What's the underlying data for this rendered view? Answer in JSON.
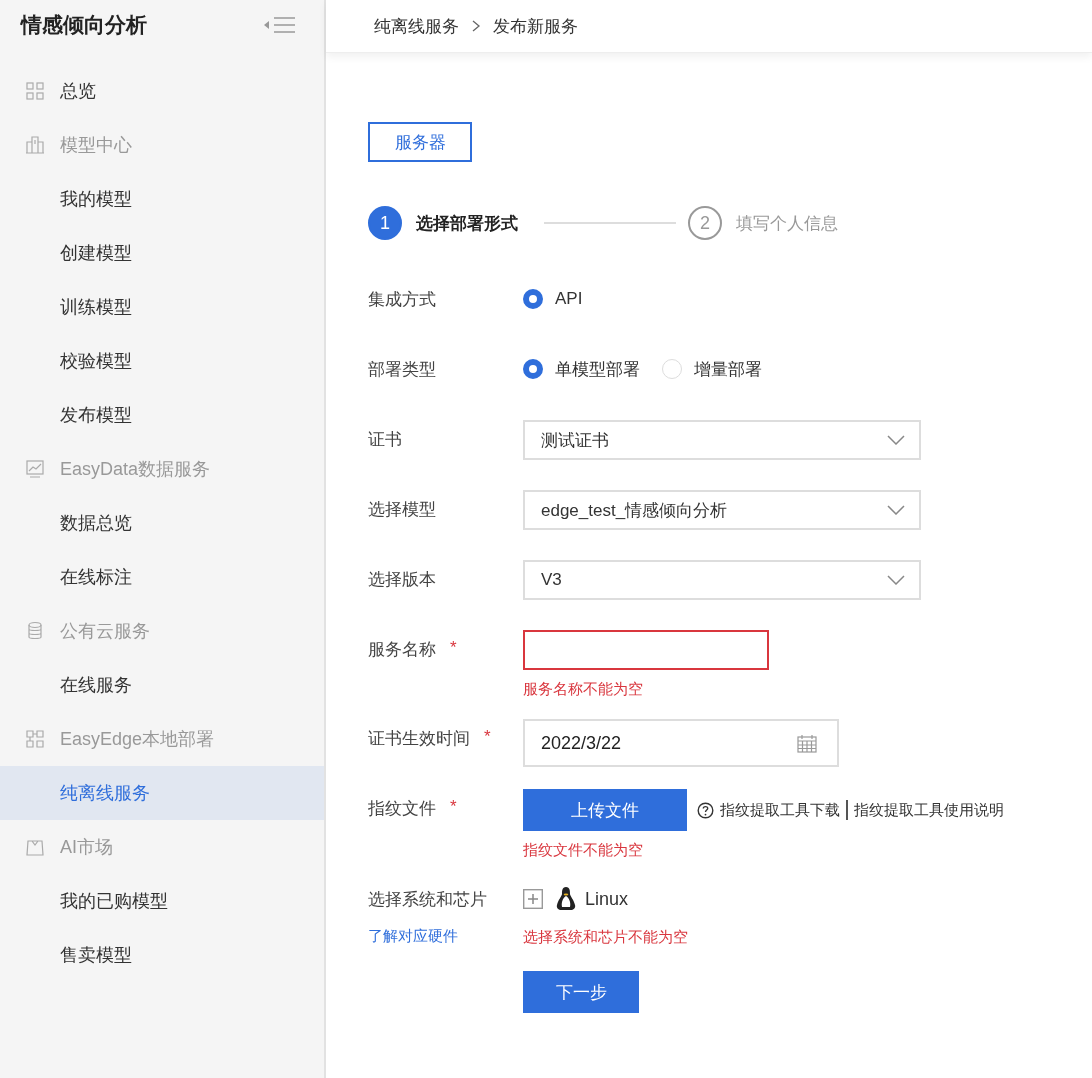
{
  "sidebar": {
    "title": "情感倾向分析",
    "items": [
      {
        "kind": "link",
        "label": "总览",
        "selected": false
      },
      {
        "kind": "group",
        "label": "模型中心",
        "selected": false
      },
      {
        "kind": "item",
        "label": "我的模型",
        "selected": false
      },
      {
        "kind": "item",
        "label": "创建模型",
        "selected": false
      },
      {
        "kind": "item",
        "label": "训练模型",
        "selected": false
      },
      {
        "kind": "item",
        "label": "校验模型",
        "selected": false
      },
      {
        "kind": "item",
        "label": "发布模型",
        "selected": false
      },
      {
        "kind": "group",
        "label": "EasyData数据服务",
        "selected": false
      },
      {
        "kind": "item",
        "label": "数据总览",
        "selected": false
      },
      {
        "kind": "item",
        "label": "在线标注",
        "selected": false
      },
      {
        "kind": "group",
        "label": "公有云服务",
        "selected": false
      },
      {
        "kind": "item",
        "label": "在线服务",
        "selected": false
      },
      {
        "kind": "group",
        "label": "EasyEdge本地部署",
        "selected": false
      },
      {
        "kind": "item",
        "label": "纯离线服务",
        "selected": true
      },
      {
        "kind": "group",
        "label": "AI市场",
        "selected": false
      },
      {
        "kind": "item",
        "label": "我的已购模型",
        "selected": false
      },
      {
        "kind": "item",
        "label": "售卖模型",
        "selected": false
      }
    ]
  },
  "breadcrumb": [
    "纯离线服务",
    "发布新服务"
  ],
  "tabs": [
    {
      "label": "服务器",
      "selected": true
    }
  ],
  "steps": [
    {
      "number": "1",
      "label": "选择部署形式",
      "selected": true
    },
    {
      "number": "2",
      "label": "填写个人信息",
      "selected": false
    }
  ],
  "form": [
    {
      "kind": "radio",
      "label": "集成方式",
      "options": [
        {
          "label": "API",
          "selected": true
        }
      ]
    },
    {
      "kind": "radio",
      "label": "部署类型",
      "options": [
        {
          "label": "单模型部署",
          "selected": true
        },
        {
          "label": "增量部署",
          "selected": false
        }
      ]
    },
    {
      "kind": "select",
      "label": "证书",
      "value": "测试证书"
    },
    {
      "kind": "select",
      "label": "选择模型",
      "value": "edge_test_情感倾向分析"
    },
    {
      "kind": "select",
      "label": "选择版本",
      "value": "V3"
    },
    {
      "kind": "text",
      "label": "服务名称",
      "required_mark": "*",
      "error": "服务名称不能为空"
    },
    {
      "kind": "date",
      "label": "证书生效时间",
      "required_mark": "*",
      "value": "2022/3/22"
    },
    {
      "kind": "upload",
      "label": "指纹文件",
      "required_mark": "*",
      "button": "上传文件",
      "links": [
        "指纹提取工具下载",
        "指纹提取工具使用说明"
      ],
      "error": "指纹文件不能为空"
    },
    {
      "kind": "os",
      "label": "选择系统和芯片",
      "link": "了解对应硬件",
      "options": [
        {
          "label": "Linux",
          "checked": false
        }
      ],
      "error": "选择系统和芯片不能为空"
    }
  ],
  "submit": "下一步"
}
